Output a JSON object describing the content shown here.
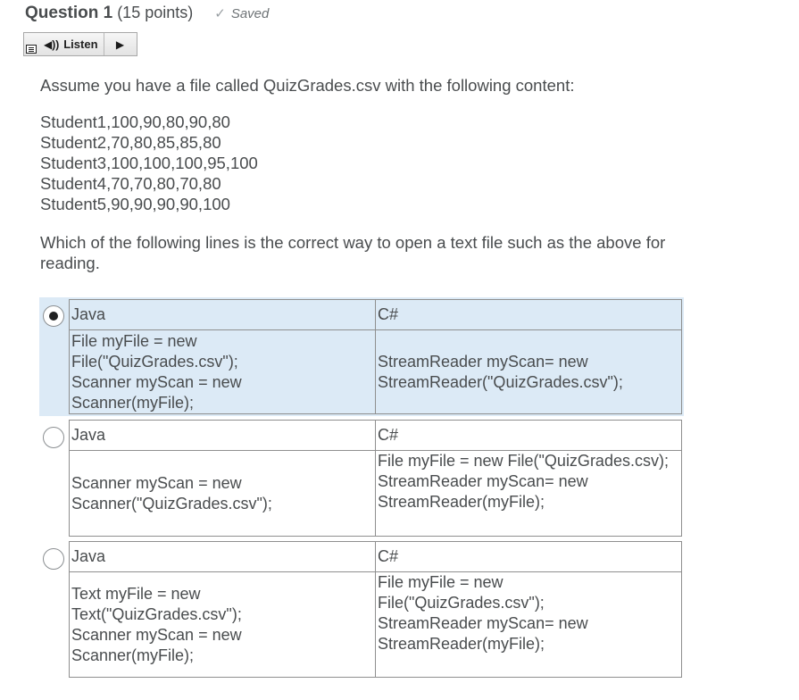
{
  "question": {
    "title": "Question 1",
    "points": "(15 points)",
    "saved_label": "Saved",
    "listen_label": "Listen",
    "icons": [
      "menu-icon",
      "speaker-icon",
      "play-icon",
      "check-icon"
    ]
  },
  "intro": "Assume you have a file called QuizGrades.csv with the following content:",
  "file_lines": [
    "Student1,100,90,80,90,80",
    "Student2,70,80,85,85,80",
    "Student3,100,100,100,95,100",
    "Student4,70,70,80,70,80",
    "Student5,90,90,90,90,100"
  ],
  "prompt": "Which of the following lines is the correct way to open a text file such as the above for reading.",
  "options": [
    {
      "selected": true,
      "col1_header": "Java",
      "col2_header": "C#",
      "java": [
        "File myFile = new",
        "File(\"QuizGrades.csv\");",
        "Scanner myScan = new",
        "Scanner(myFile);"
      ],
      "csharp": [
        "StreamReader myScan= new",
        "StreamReader(\"QuizGrades.csv\");"
      ]
    },
    {
      "selected": false,
      "col1_header": "Java",
      "col2_header": "C#",
      "java": [
        "Scanner myScan = new",
        "Scanner(\"QuizGrades.csv\");"
      ],
      "csharp": [
        "File myFile = new File(\"QuizGrades.csv);",
        "StreamReader myScan= new",
        "StreamReader(myFile);"
      ]
    },
    {
      "selected": false,
      "col1_header": "Java",
      "col2_header": "C#",
      "java": [
        "Text myFile = new",
        "Text(\"QuizGrades.csv\");",
        "Scanner myScan = new",
        "Scanner(myFile);"
      ],
      "csharp": [
        "File myFile = new",
        "File(\"QuizGrades.csv\");",
        "StreamReader myScan= new",
        "StreamReader(myFile);"
      ]
    }
  ],
  "colors": {
    "selected_bg": "#dceaf6",
    "text": "#494c4e",
    "border": "#8f8f8f"
  }
}
